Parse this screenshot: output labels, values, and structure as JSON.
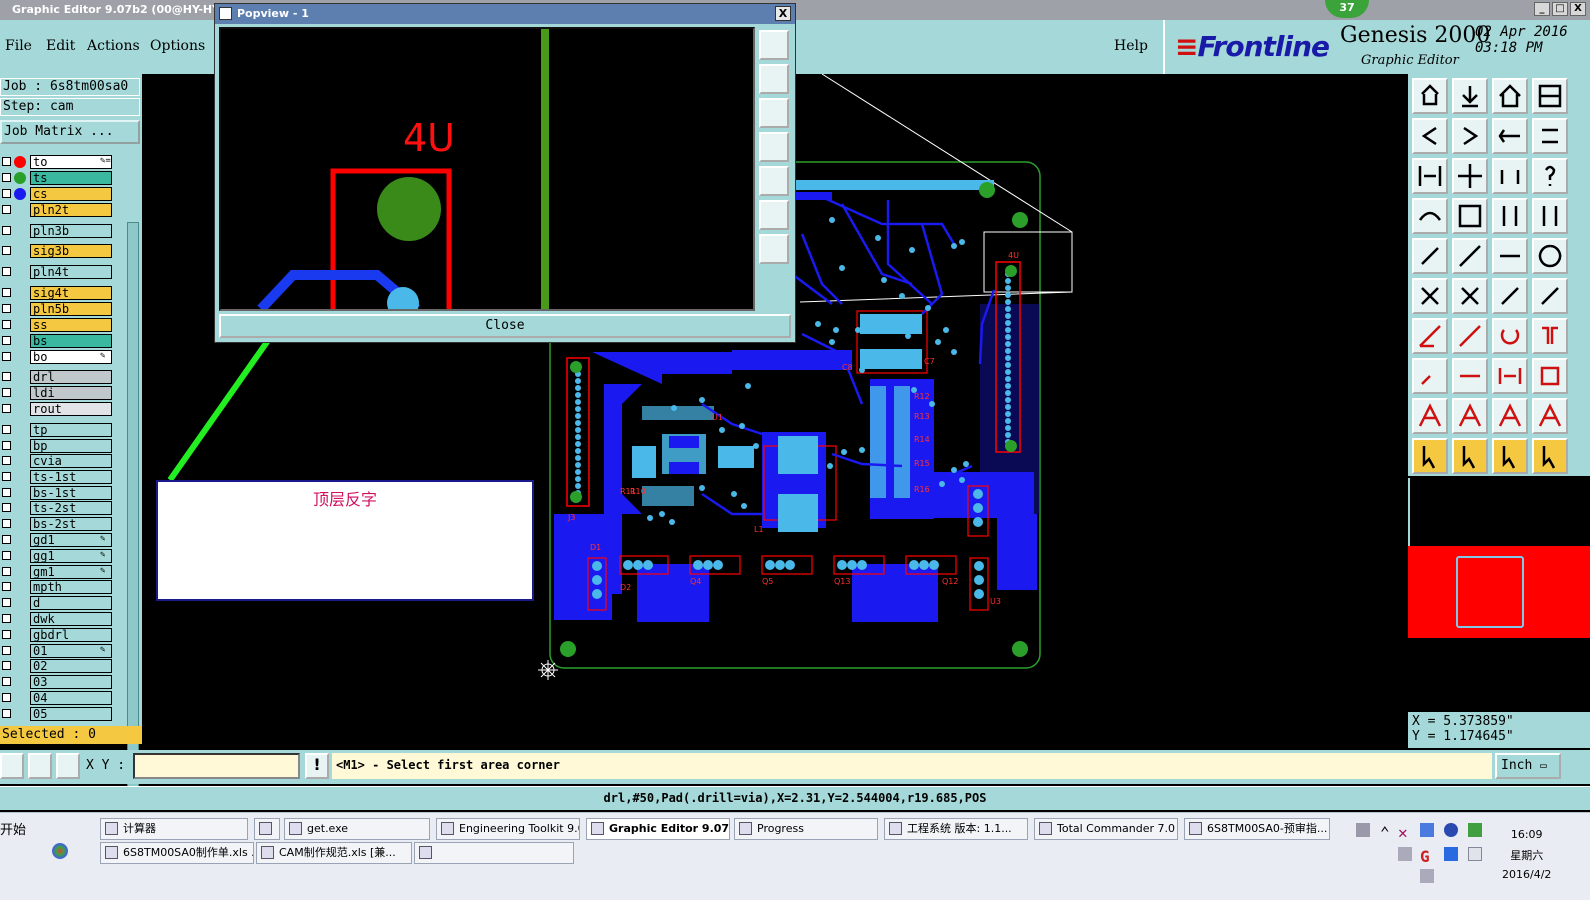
{
  "window": {
    "title": "Graphic Editor 9.07b2 (00@HY-HYCAM",
    "badge": "37",
    "controls": [
      "_",
      "□",
      "X"
    ]
  },
  "menu": {
    "file": "File",
    "edit": "Edit",
    "actions": "Actions",
    "options": "Options",
    "help": "Help"
  },
  "brand": {
    "logo": "Frontline",
    "product": "Genesis 2000",
    "subtitle": "Graphic Editor",
    "date": "02 Apr 2016",
    "time": "03:18 PM"
  },
  "job": {
    "job_line": "Job : 6s8tm00sa0",
    "step_line": "Step: cam",
    "matrix_button": "Job Matrix ..."
  },
  "layers": [
    {
      "name": "to",
      "color": "#ffffff",
      "dot": "#ff0000",
      "mark": "✎="
    },
    {
      "name": "ts",
      "color": "#3ab8a0",
      "dot": "#2aa02a",
      "mark": ""
    },
    {
      "name": "cs",
      "color": "#f5c842",
      "dot": "#1a1af0",
      "mark": ""
    },
    {
      "name": "pln2t",
      "color": "#f5c842",
      "dot": "",
      "mark": ""
    },
    {
      "name": "pln3b",
      "color": "#a5d8d8",
      "dot": "",
      "mark": ""
    },
    {
      "name": "sig3b",
      "color": "#f5c842",
      "dot": "",
      "mark": ""
    },
    {
      "name": "pln4t",
      "color": "#a5d8d8",
      "dot": "",
      "mark": ""
    },
    {
      "name": "sig4t",
      "color": "#f5c842",
      "dot": "",
      "mark": ""
    },
    {
      "name": "pln5b",
      "color": "#f5c842",
      "dot": "",
      "mark": ""
    },
    {
      "name": "ss",
      "color": "#f5c842",
      "dot": "",
      "mark": ""
    },
    {
      "name": "bs",
      "color": "#3ab8a0",
      "dot": "",
      "mark": ""
    },
    {
      "name": "bo",
      "color": "#ffffff",
      "dot": "",
      "mark": "✎"
    },
    {
      "name": "drl",
      "color": "#c0c8cc",
      "dot": "",
      "mark": ""
    },
    {
      "name": "ldi",
      "color": "#c0c8cc",
      "dot": "",
      "mark": ""
    },
    {
      "name": "rout",
      "color": "#e0e4e6",
      "dot": "",
      "mark": ""
    },
    {
      "name": "tp",
      "color": "#a5d8d8",
      "dot": "",
      "mark": ""
    },
    {
      "name": "bp",
      "color": "#a5d8d8",
      "dot": "",
      "mark": ""
    },
    {
      "name": "cvia",
      "color": "#a5d8d8",
      "dot": "",
      "mark": ""
    },
    {
      "name": "ts-1st",
      "color": "#a5d8d8",
      "dot": "",
      "mark": ""
    },
    {
      "name": "bs-1st",
      "color": "#a5d8d8",
      "dot": "",
      "mark": ""
    },
    {
      "name": "ts-2st",
      "color": "#a5d8d8",
      "dot": "",
      "mark": ""
    },
    {
      "name": "bs-2st",
      "color": "#a5d8d8",
      "dot": "",
      "mark": ""
    },
    {
      "name": "gd1",
      "color": "#a5d8d8",
      "dot": "",
      "mark": "✎"
    },
    {
      "name": "gg1",
      "color": "#a5d8d8",
      "dot": "",
      "mark": "✎"
    },
    {
      "name": "gm1",
      "color": "#a5d8d8",
      "dot": "",
      "mark": "✎"
    },
    {
      "name": "mpth",
      "color": "#a5d8d8",
      "dot": "",
      "mark": ""
    },
    {
      "name": "d",
      "color": "#a5d8d8",
      "dot": "",
      "mark": ""
    },
    {
      "name": "dwk",
      "color": "#a5d8d8",
      "dot": "",
      "mark": ""
    },
    {
      "name": "gbdrl",
      "color": "#a5d8d8",
      "dot": "",
      "mark": ""
    },
    {
      "name": "01",
      "color": "#a5d8d8",
      "dot": "",
      "mark": "✎"
    },
    {
      "name": "02",
      "color": "#a5d8d8",
      "dot": "",
      "mark": ""
    },
    {
      "name": "03",
      "color": "#a5d8d8",
      "dot": "",
      "mark": ""
    },
    {
      "name": "04",
      "color": "#a5d8d8",
      "dot": "",
      "mark": ""
    },
    {
      "name": "05",
      "color": "#a5d8d8",
      "dot": "",
      "mark": ""
    }
  ],
  "selected": "Selected : 0",
  "popview": {
    "title": "Popview - 1",
    "label": "4U",
    "close_label": "Close",
    "close_x": "X"
  },
  "annotation": {
    "text": "顶层反字"
  },
  "board_labels": {
    "u1": "U1",
    "d1": "D1",
    "d2": "D2",
    "q4": "Q4",
    "q5": "Q5",
    "q13": "Q13",
    "q12": "Q12",
    "l1": "L1",
    "u4": "4U",
    "c8": "C8",
    "c7": "C7",
    "r12": "R12",
    "r13": "R13",
    "r14": "R14",
    "r15": "R15",
    "r16": "R16",
    "r10": "R10",
    "r11": "R11",
    "j3": "J3",
    "u3": "U3"
  },
  "coords": {
    "x": "X  = 5.373859\"",
    "y": "Y  = 1.174645\""
  },
  "command": {
    "xy_label": "X Y :",
    "xy_value": "",
    "message": "<M1> - Select first area corner",
    "units": "Inch"
  },
  "status": "drl,#50,Pad(.drill=via),X=2.31,Y=2.544004,r19.685,POS",
  "taskbar": {
    "start": "开始",
    "row1": [
      "计算器",
      "",
      "get.exe",
      "Engineering Toolkit 9.0...",
      "Graphic Editor 9.07b...",
      "Progress",
      "工程系统  版本: 1.1...",
      "Total Commander 7.0 ...",
      "6S8TM00SA0-预审指..."
    ],
    "row2": [
      "6S8TM00SA0制作单.xls ...",
      "CAM制作规范.xls [兼...",
      ""
    ],
    "clock_time": "16:09",
    "clock_day": "星期六",
    "clock_date": "2016/4/2"
  },
  "colors": {
    "panel": "#a5d8d8",
    "highlight": "#f5c842",
    "copper": "#1a1af0",
    "pad": "#4ab8e8",
    "outline": "#2aa02a",
    "silk": "#ff0000",
    "arrow": "#22ee22"
  }
}
